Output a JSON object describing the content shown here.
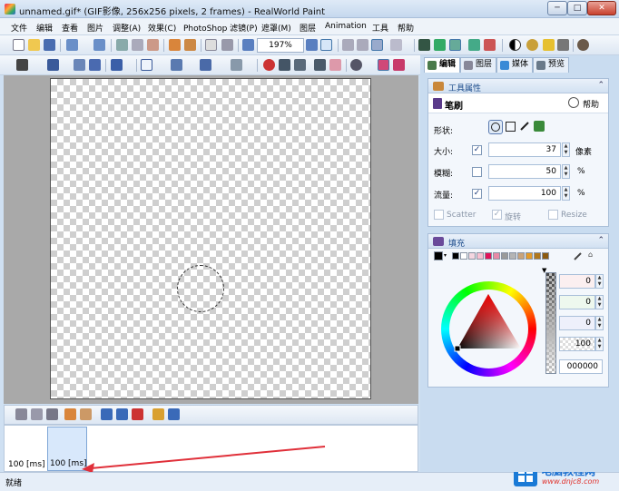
{
  "window": {
    "title": "unnamed.gif* (GIF影像, 256x256 pixels, 2 frames) - RealWorld Paint",
    "controls": {
      "minimize": "─",
      "maximize": "□",
      "close": "✕"
    }
  },
  "menu": {
    "items": [
      "文件",
      "编辑",
      "查看",
      "图片",
      "调整(A)",
      "效果(C)",
      "PhotoShop 滤镜(P)",
      "遮罩(M)",
      "图层",
      "Animation",
      "工具",
      "帮助"
    ]
  },
  "toolbar": {
    "zoom_value": "197%"
  },
  "panel_tabs": {
    "edit": "编辑",
    "layers": "图层",
    "media": "媒体",
    "preview": "预览"
  },
  "tool_properties": {
    "section_title": "工具属性",
    "tool_name": "笔刷",
    "help_label": "帮助",
    "shape_label": "形状:",
    "size_label": "大小:",
    "size_value": "37",
    "size_unit": "像素",
    "blur_label": "模糊:",
    "blur_value": "50",
    "blur_unit": "%",
    "flow_label": "流量:",
    "flow_value": "100",
    "flow_unit": "%",
    "scatter_label": "Scatter",
    "rotate_label": "旋转",
    "resize_label": "Resize"
  },
  "fill": {
    "section_title": "填充",
    "swatches": [
      "#000000",
      "#ffffff",
      "#f4d6e0",
      "#f8c0d0",
      "#e0145a",
      "#e88aa6",
      "#9a9a9a",
      "#b4b4b4",
      "#c9a37a",
      "#e39a2a",
      "#b0771c",
      "#8b5a10"
    ],
    "channel_values": [
      "0",
      "0",
      "0"
    ],
    "alpha_value": "100",
    "hex_value": "000000"
  },
  "frames": {
    "labels": [
      "100 [ms]",
      "100 [ms]"
    ]
  },
  "status": {
    "text": "就绪"
  },
  "watermark": {
    "text": "电脑教程网",
    "url": "www.dnjc8.com"
  }
}
